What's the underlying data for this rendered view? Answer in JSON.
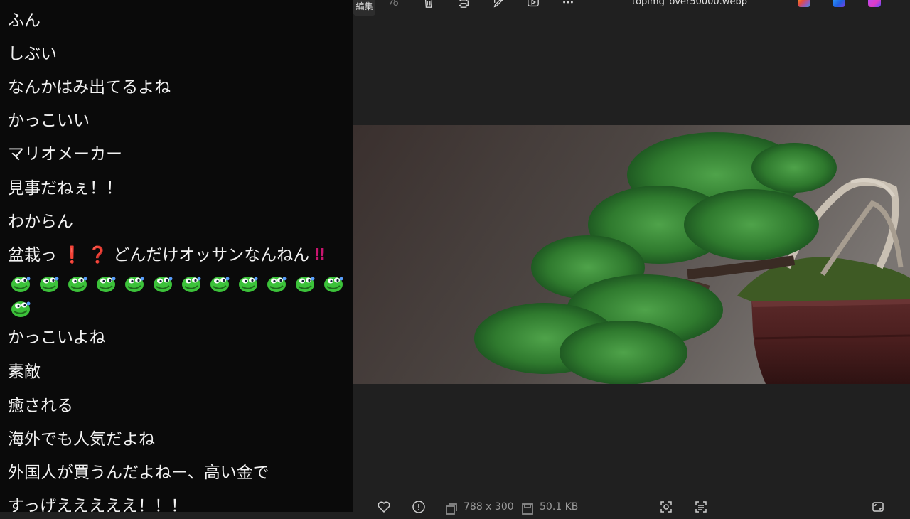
{
  "chat": {
    "messages": [
      "ふん",
      "しぶい",
      "なんかはみ出てるよね",
      "かっこいい",
      "マリオメーカー",
      "見事だねぇ！！",
      "わからん",
      "かっこいよね",
      "素敵",
      "癒される",
      "海外でも人気だよね",
      "外国人が買うんだよねー、高い金で",
      "すっげえええええ！！！"
    ],
    "special_message": {
      "prefix": "盆栽っ",
      "mark1": "❗",
      "mark2": "❓",
      "middle": "どんだけオッサンなんねん",
      "mark3": "‼"
    },
    "emote_name": "green-frog-emote",
    "emote_count_row1": 13,
    "emote_count_row2": 1
  },
  "viewer": {
    "edit_label": "編集",
    "file_name": "topimg_over50000.webp",
    "dimensions": "788 x 300",
    "file_size": "50.1 KB",
    "toolbar_icons": [
      "edit-button",
      "background-remove-icon",
      "delete-icon",
      "print-icon",
      "edit-image-icon",
      "slideshow-icon",
      "more-icon"
    ],
    "app_icons": [
      "copilot-icon",
      "clipchamp-icon",
      "designer-icon"
    ],
    "bottom_icons": [
      "favorite-icon",
      "info-icon",
      "dimensions-icon",
      "file-size-icon",
      "visual-search-icon",
      "text-extract-icon",
      "fullscreen-icon"
    ],
    "colors": {
      "chat_bg": "#0a0a0a",
      "viewer_bg": "#202020",
      "chat_text": "#f2f2f2",
      "emote_green": "#3cc23a",
      "pot_color": "#4a1e1e"
    }
  }
}
